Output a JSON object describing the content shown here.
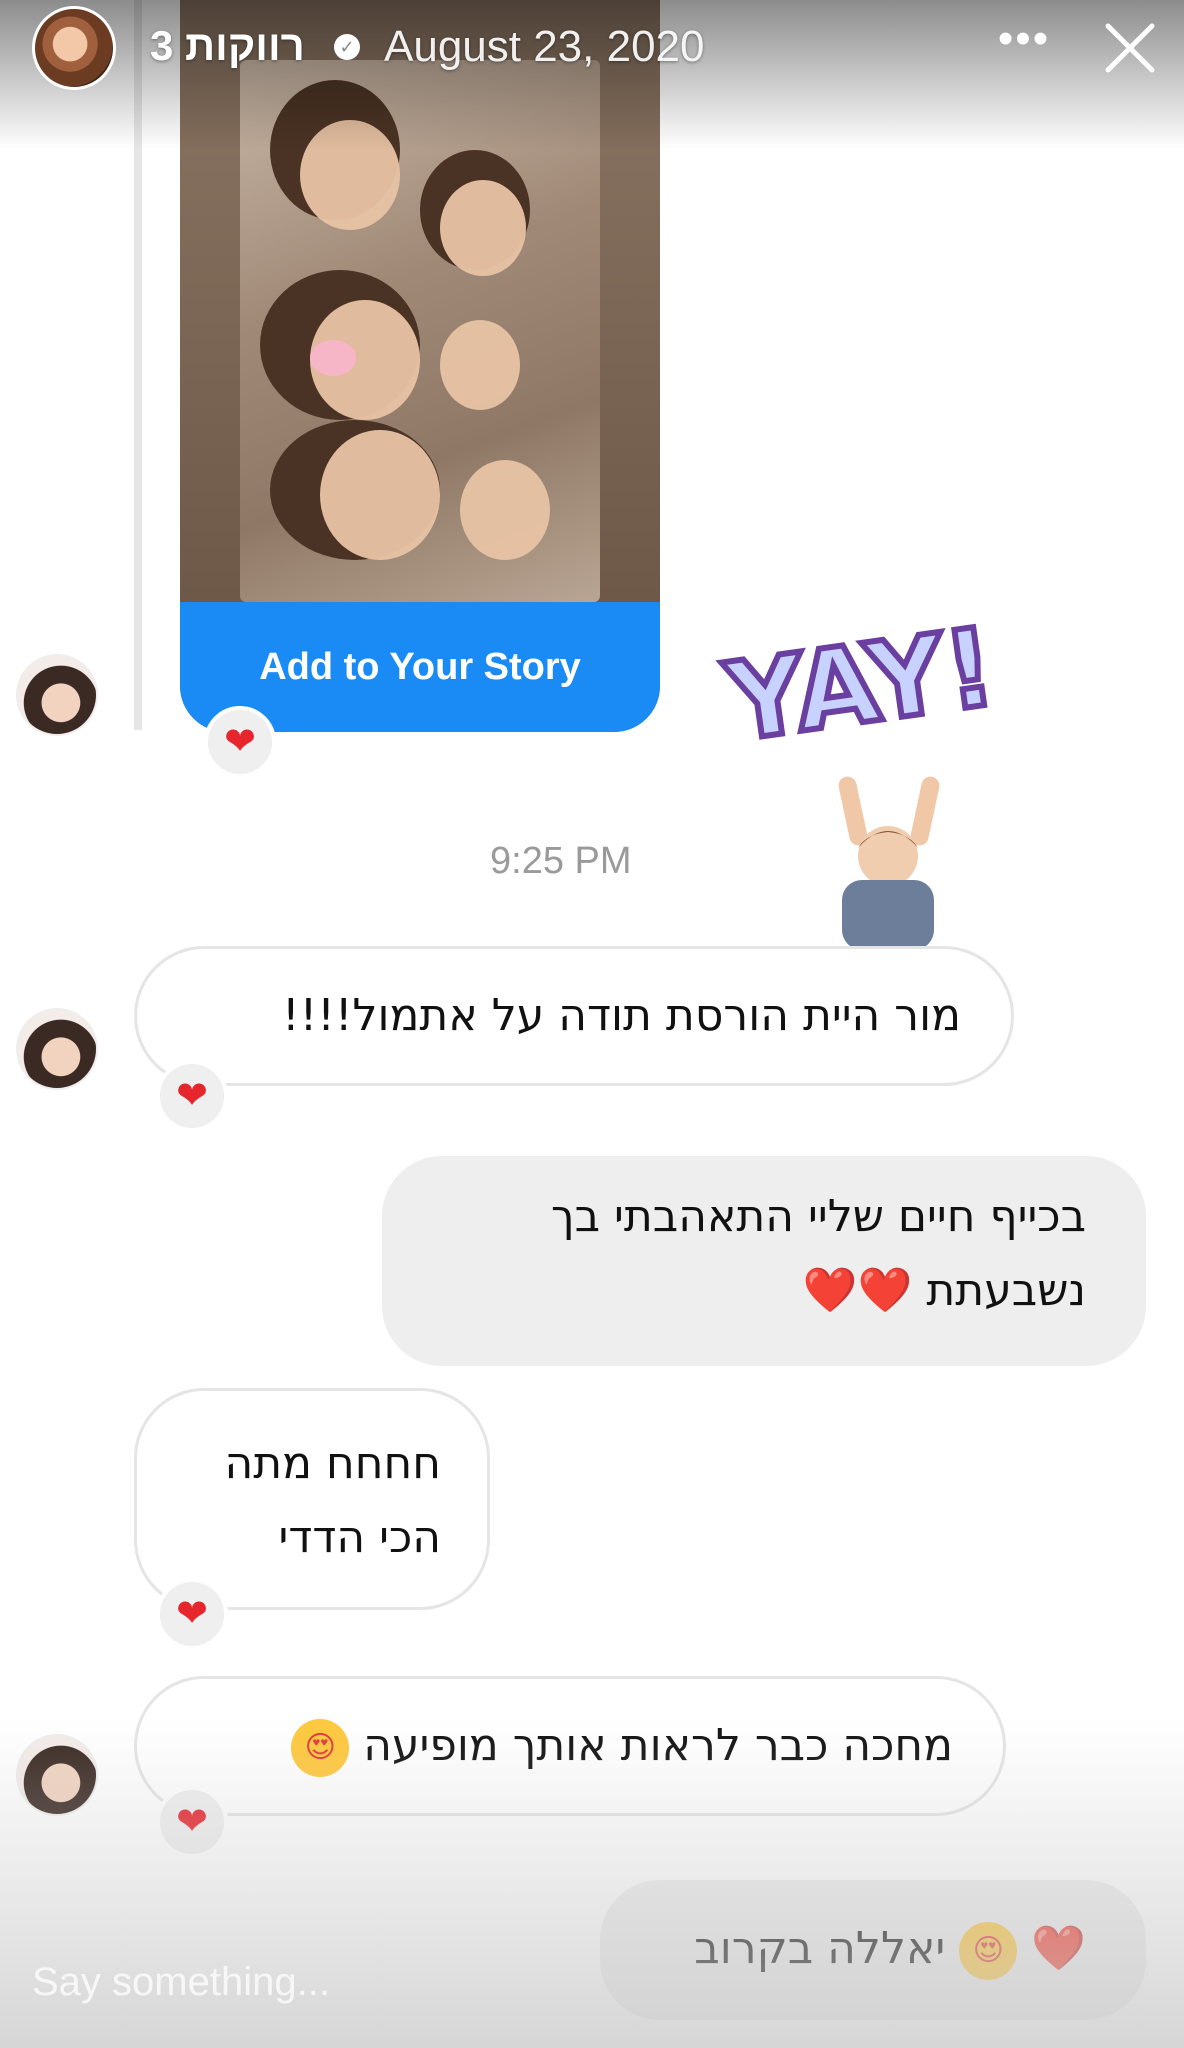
{
  "header": {
    "username": "רווקות 3",
    "date": "August 23, 2020",
    "more_glyph": "•••",
    "close_icon": "close-icon"
  },
  "story_share": {
    "button_label": "Add to Your Story",
    "reaction": "❤"
  },
  "stickers": {
    "yay_text": "YAY!"
  },
  "timestamp": "9:25 PM",
  "messages": [
    {
      "side": "incoming",
      "text": "מור היית הורסת תודה על אתמול!!!!",
      "reaction": "❤"
    },
    {
      "side": "outgoing",
      "line1": "בכייף חיים שליי התאהבתי בך",
      "line2": "נשבעתת",
      "hearts": "❤️❤️"
    },
    {
      "side": "incoming",
      "line1": "חחחח מתה",
      "line2": "הכי הדדי",
      "reaction": "❤"
    },
    {
      "side": "incoming",
      "text": "מחכה כבר לראות אותך מופיעה",
      "emoji": "😍",
      "reaction": "❤"
    },
    {
      "side": "outgoing",
      "text": "יאללה בקרוב",
      "emoji": "😍",
      "heart": "❤️"
    }
  ],
  "composer": {
    "placeholder": "Say something..."
  },
  "colors": {
    "accent_blue": "#1a8af5",
    "heart_red": "#e7252d",
    "incoming_border": "#e5e5e5",
    "outgoing_bg": "#eeeeee"
  }
}
